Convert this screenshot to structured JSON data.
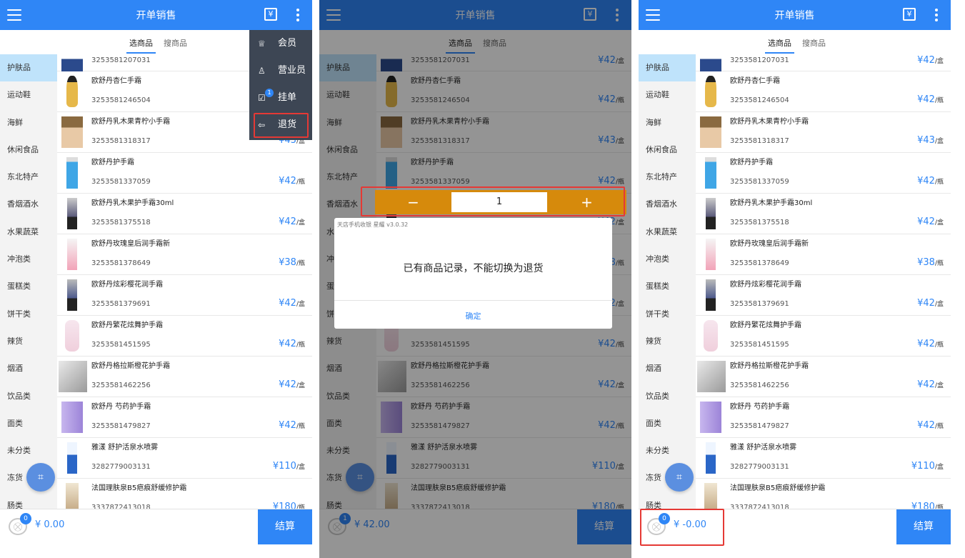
{
  "app": {
    "title": "开单销售",
    "tab_active": "选商品",
    "tab_other": "搜商品",
    "checkout_label": "结算"
  },
  "colors": {
    "primary": "#2f86f6",
    "highlight": "#e53935",
    "stepper": "#d68a0c"
  },
  "categories": [
    "护肤品",
    "运动鞋",
    "海鲜",
    "休闲食品",
    "东北特产",
    "香烟酒水",
    "水果蔬菜",
    "冲泡类",
    "蛋糕类",
    "饼干类",
    "辣货",
    "烟酒",
    "饮品类",
    "面类",
    "未分类",
    "冻货",
    "肠类"
  ],
  "products": [
    {
      "name": "",
      "code": "3253581207031",
      "price": "¥42",
      "unit": "/盒",
      "image": "tube-cream",
      "partial": true
    },
    {
      "name": "欧舒丹杏仁手霜",
      "code": "3253581246504",
      "price": "¥42",
      "unit": "/瓶",
      "image": "oil-bottle"
    },
    {
      "name": "欧舒丹乳木果青柠小手霜",
      "code": "3253581318317",
      "price": "¥43",
      "unit": "/盒",
      "image": "foundation-bottle"
    },
    {
      "name": "欧舒丹护手霜",
      "code": "3253581337059",
      "price": "¥42",
      "unit": "/瓶",
      "image": "blue-toner"
    },
    {
      "name": "欧舒丹乳木果护手霜30ml",
      "code": "3253581375518",
      "price": "¥42",
      "unit": "/盒",
      "image": "hand-cream-tube"
    },
    {
      "name": "欧舒丹玫瑰皇后润手霜新",
      "code": "3253581378649",
      "price": "¥38",
      "unit": "/瓶",
      "image": "rose-tube"
    },
    {
      "name": "欧舒丹炫彩樱花润手霜",
      "code": "3253581379691",
      "price": "¥42",
      "unit": "/盒",
      "image": "cherry-tube"
    },
    {
      "name": "欧舒丹繁花炫舞护手霜",
      "code": "3253581451595",
      "price": "¥42",
      "unit": "/瓶",
      "image": "pink-bottle"
    },
    {
      "name": "欧舒丹格拉斯橙花护手霜",
      "code": "3253581462256",
      "price": "¥42",
      "unit": "/盒",
      "image": "white-tube-photo"
    },
    {
      "name": "欧舒丹 芍药护手霜",
      "code": "3253581479827",
      "price": "¥42",
      "unit": "/瓶",
      "image": "purple-box"
    },
    {
      "name": "雅漾 舒护活泉水喷雾",
      "code": "3282779003131",
      "price": "¥110",
      "unit": "/盒",
      "image": "spray-can"
    },
    {
      "name": "法国理肤泉B5疤痕舒缓修护霜",
      "code": "3337872413018",
      "price": "¥180",
      "unit": "/瓶",
      "image": "cream-tube"
    }
  ],
  "screen1": {
    "cart_count": "0",
    "amount": "¥ 0.00",
    "menu": [
      {
        "label": "会员",
        "icon": "crown-icon",
        "glyph": "♕"
      },
      {
        "label": "营业员",
        "icon": "person-icon",
        "glyph": "♙"
      },
      {
        "label": "挂单",
        "icon": "hold-order-icon",
        "glyph": "☑",
        "badge": "1"
      },
      {
        "label": "退货",
        "icon": "return-icon",
        "glyph": "⇦"
      }
    ]
  },
  "screen2": {
    "cart_count": "1",
    "amount": "¥ 42.00",
    "stepper": {
      "minus": "−",
      "value": "1",
      "plus": "+"
    },
    "dialog": {
      "header": "天店手机收银 星耀 v3.0.32",
      "message": "已有商品记录，不能切换为退货",
      "button": "确定"
    }
  },
  "screen3": {
    "cart_count": "0",
    "amount": "¥ -0.00"
  }
}
